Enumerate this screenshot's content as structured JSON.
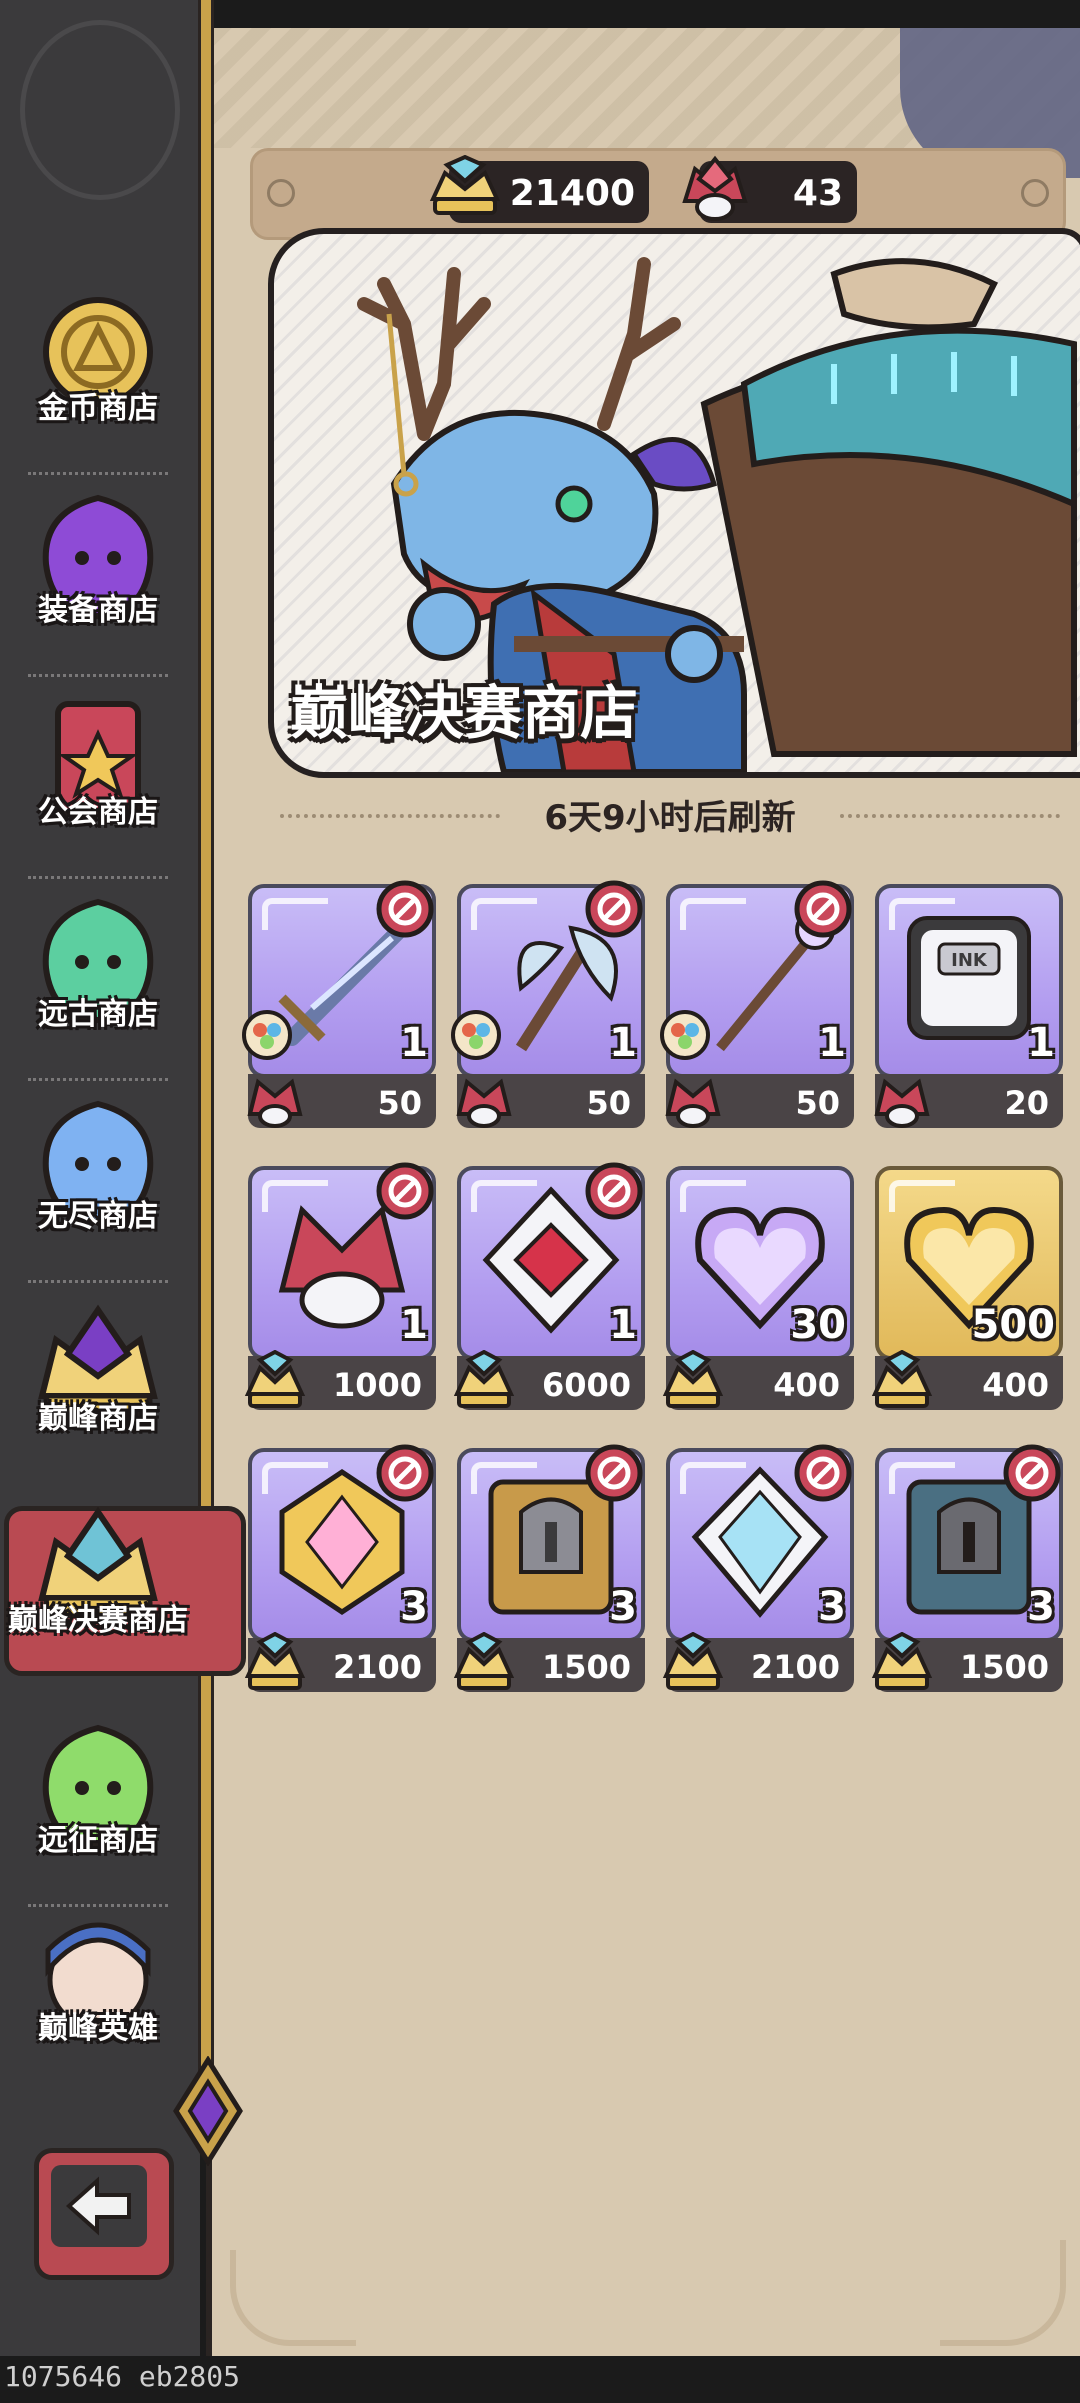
{
  "currency": {
    "gems_value": "21400",
    "tokens_value": "43"
  },
  "banner": {
    "title": "巅峰决赛商店"
  },
  "refresh_text": "6天9小时后刷新",
  "items": [
    {
      "name": "sword",
      "qty": "1",
      "price": "50",
      "currency": "token",
      "locked": true
    },
    {
      "name": "axe",
      "qty": "1",
      "price": "50",
      "currency": "token",
      "locked": true
    },
    {
      "name": "staff",
      "qty": "1",
      "price": "50",
      "currency": "token",
      "locked": true
    },
    {
      "name": "ink-box",
      "qty": "1",
      "price": "20",
      "currency": "token",
      "locked": false,
      "ink_label": "INK"
    },
    {
      "name": "token-chest",
      "qty": "1",
      "price": "1000",
      "currency": "gem",
      "locked": true
    },
    {
      "name": "emblem",
      "qty": "1",
      "price": "6000",
      "currency": "gem",
      "locked": true
    },
    {
      "name": "purple-heart",
      "qty": "30",
      "price": "400",
      "currency": "gem",
      "locked": false
    },
    {
      "name": "gold-heart",
      "qty": "500",
      "price": "400",
      "currency": "gem",
      "locked": false
    },
    {
      "name": "amber-crystal",
      "qty": "3",
      "price": "2100",
      "currency": "gem",
      "locked": true
    },
    {
      "name": "gold-helmet-book",
      "qty": "3",
      "price": "1500",
      "currency": "gem",
      "locked": true
    },
    {
      "name": "blue-crystal",
      "qty": "3",
      "price": "2100",
      "currency": "gem",
      "locked": true
    },
    {
      "name": "dark-helmet-book",
      "qty": "3",
      "price": "1500",
      "currency": "gem",
      "locked": true
    }
  ],
  "sidebar": [
    {
      "label": "金币商店",
      "icon": "coin-icon",
      "color": "#e7c25a"
    },
    {
      "label": "装备商店",
      "icon": "equipment-icon",
      "color": "#8e4bd6"
    },
    {
      "label": "公会商店",
      "icon": "guild-icon",
      "color": "#c9475a"
    },
    {
      "label": "远古商店",
      "icon": "ancient-icon",
      "color": "#5ccfa0"
    },
    {
      "label": "无尽商店",
      "icon": "endless-icon",
      "color": "#7fb2f2"
    },
    {
      "label": "巅峰商店",
      "icon": "peak-icon",
      "color": "#7a3fc4"
    },
    {
      "label": "巅峰决赛商店",
      "icon": "peak-final-icon",
      "color": "#6fc3d6",
      "active": true
    },
    {
      "label": "远征商店",
      "icon": "expedition-icon",
      "color": "#8fdc6b"
    },
    {
      "label": "巅峰英雄",
      "icon": "hero-icon",
      "color": "#4a6fc4"
    }
  ],
  "footer": {
    "id_text": "1075646 eb2805"
  }
}
